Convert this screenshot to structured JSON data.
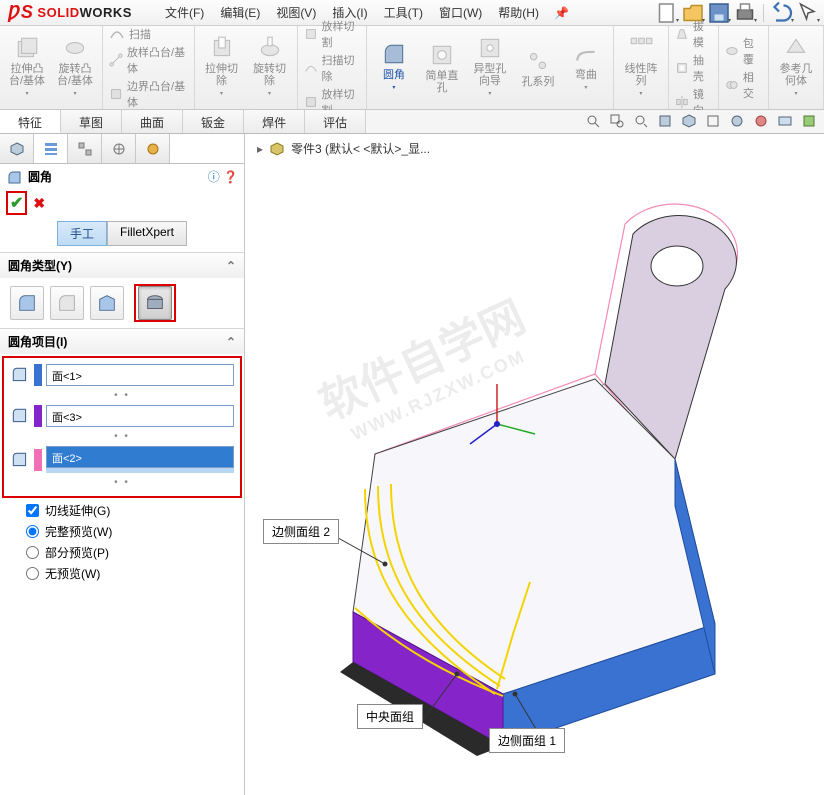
{
  "app": {
    "name1": "SOLID",
    "name2": "WORKS"
  },
  "menu": {
    "file": "文件(F)",
    "edit": "编辑(E)",
    "view": "视图(V)",
    "insert": "插入(I)",
    "tools": "工具(T)",
    "window": "窗口(W)",
    "help": "帮助(H)"
  },
  "ribbon": {
    "extrude": "拉伸凸台/基体",
    "revolve": "旋转凸台/基体",
    "sweep": "扫描",
    "loft": "放样凸台/基体",
    "boundary": "边界凸台/基体",
    "cut_extrude": "拉伸切除",
    "cut_revolve": "旋转切除",
    "cut_sweep": "扫描切除",
    "cut_loft": "放样切割",
    "cut_boundary": "放样切割",
    "cut_boundary2": "放样切割",
    "fillet": "圆角",
    "hole_simple": "简单直孔",
    "hole_wizard": "异型孔向导",
    "hole_series": "孔系列",
    "bend": "弯曲",
    "lpattern": "线性阵列",
    "draft": "拔模",
    "shell": "抽壳",
    "mirror": "镜向",
    "wrap": "包覆",
    "intersect": "相交",
    "refgeom": "参考几何体"
  },
  "tabs": {
    "feature": "特征",
    "sketch": "草图",
    "surface": "曲面",
    "sheetmetal": "钣金",
    "weldment": "焊件",
    "evaluate": "评估"
  },
  "pm": {
    "title": "圆角",
    "mode_manual": "手工",
    "mode_xpert": "FilletXpert",
    "sec_type": "圆角类型(Y)",
    "sec_items": "圆角项目(I)",
    "face1": "面<1>",
    "face3": "面<3>",
    "face2": "面<2>",
    "tangent": "切线延伸(G)",
    "full": "完整预览(W)",
    "partial": "部分预览(P)",
    "none": "无预览(W)"
  },
  "crumb": {
    "part": "零件3  (默认< <默认>_显..."
  },
  "callouts": {
    "side2": "边侧面组 2",
    "center": "中央面组",
    "side1": "边侧面组 1"
  },
  "watermark": {
    "l1": "软件自学网",
    "l2": "WWW.RJZXW.COM"
  }
}
